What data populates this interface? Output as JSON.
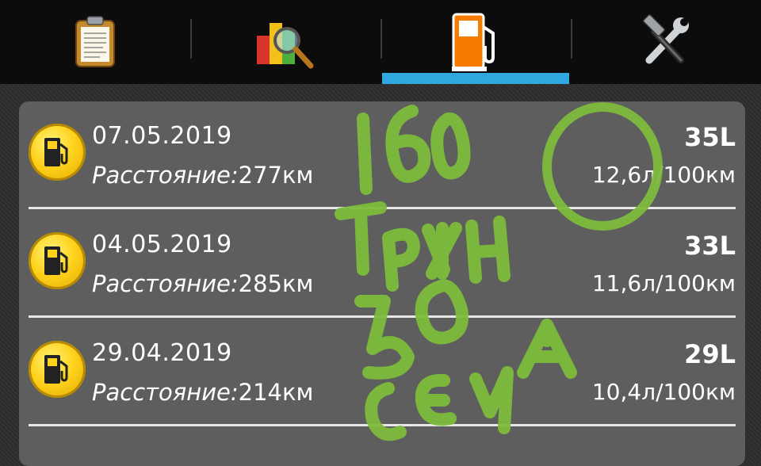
{
  "tabs": [
    {
      "name": "log",
      "icon": "clipboard-icon",
      "active": false
    },
    {
      "name": "statistics",
      "icon": "chart-magnifier-icon",
      "active": false
    },
    {
      "name": "fuel",
      "icon": "fuel-pump-icon",
      "active": true
    },
    {
      "name": "tools",
      "icon": "wrench-hammer-icon",
      "active": false
    }
  ],
  "colors": {
    "accent": "#2fa8df",
    "panel": "#5e5e5e",
    "tabbar": "#0c0c0c",
    "badge": "#ffd21c",
    "annotation": "#7dbb3c"
  },
  "refuels": [
    {
      "date": "07.05.2019",
      "distance_label": "Расстояние:",
      "distance_value": "277км",
      "liters": "35L",
      "consumption": "12,6л/100км"
    },
    {
      "date": "04.05.2019",
      "distance_label": "Расстояние:",
      "distance_value": "285км",
      "liters": "33L",
      "consumption": "11,6л/100км"
    },
    {
      "date": "29.04.2019",
      "distance_label": "Расстояние:",
      "distance_value": "214км",
      "liters": "29L",
      "consumption": "10,4л/100км"
    }
  ]
}
